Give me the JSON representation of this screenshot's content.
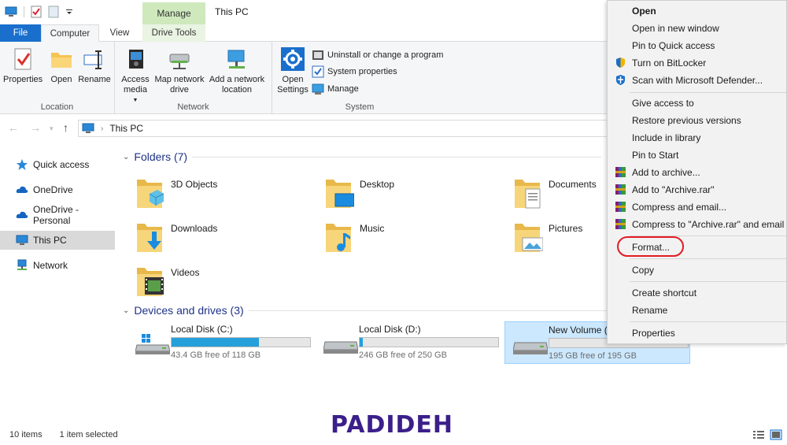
{
  "window": {
    "title": "This PC",
    "context_tab_group": "Manage"
  },
  "tabs": [
    "File",
    "Computer",
    "View",
    "Drive Tools"
  ],
  "ribbon": {
    "location": {
      "label": "Location",
      "buttons": [
        "Properties",
        "Open",
        "Rename"
      ]
    },
    "network": {
      "label": "Network",
      "access_media": "Access media",
      "map_network_drive": "Map network drive",
      "add_network_location": "Add a network location"
    },
    "system": {
      "label": "System",
      "open_settings": "Open Settings",
      "uninstall": "Uninstall or change a program",
      "system_properties": "System properties",
      "manage": "Manage"
    }
  },
  "address": {
    "path": "This PC"
  },
  "sidebar": {
    "items": [
      {
        "label": "Quick access",
        "icon": "star-icon"
      },
      {
        "label": "OneDrive",
        "icon": "cloud-icon"
      },
      {
        "label": "OneDrive - Personal",
        "icon": "cloud-icon"
      },
      {
        "label": "This PC",
        "icon": "computer-icon",
        "selected": true
      },
      {
        "label": "Network",
        "icon": "network-icon"
      }
    ]
  },
  "folders": {
    "heading": "Folders (7)",
    "items": [
      "3D Objects",
      "Desktop",
      "Documents",
      "Downloads",
      "Music",
      "Pictures",
      "Videos"
    ]
  },
  "drives": {
    "heading": "Devices and drives (3)",
    "items": [
      {
        "name": "Local Disk (C:)",
        "free": "43.4 GB free of 118 GB",
        "used_fraction": 0.63
      },
      {
        "name": "Local Disk (D:)",
        "free": "246 GB free of 250 GB",
        "used_fraction": 0.02
      },
      {
        "name": "New Volume (E",
        "free": "195 GB free of 195 GB",
        "used_fraction": 0.0
      }
    ]
  },
  "status": {
    "items_count": "10 items",
    "selection": "1 item selected"
  },
  "watermark": "PADIDEH",
  "context_menu": {
    "items": [
      {
        "label": "Open",
        "bold": true
      },
      {
        "label": "Open in new window"
      },
      {
        "label": "Pin to Quick access"
      },
      {
        "label": "Turn on BitLocker",
        "icon": "shield-icon"
      },
      {
        "label": "Scan with Microsoft Defender...",
        "icon": "defender-icon"
      },
      {
        "label": "Give access to"
      },
      {
        "label": "Restore previous versions"
      },
      {
        "label": "Include in library"
      },
      {
        "label": "Pin to Start"
      },
      {
        "label": "Add to archive...",
        "icon": "winrar-icon"
      },
      {
        "label": "Add to \"Archive.rar\"",
        "icon": "winrar-icon"
      },
      {
        "label": "Compress and email...",
        "icon": "winrar-icon"
      },
      {
        "label": "Compress to \"Archive.rar\" and email",
        "icon": "winrar-icon"
      },
      {
        "label": "Format..."
      },
      {
        "label": "Copy"
      },
      {
        "label": "Create shortcut"
      },
      {
        "label": "Rename"
      },
      {
        "label": "Properties"
      }
    ],
    "highlighted": "Format..."
  },
  "colors": {
    "accent": "#1a6fcc",
    "progress": "#26a0da",
    "selection": "#cce8ff",
    "highlight_ring": "#e11b22",
    "watermark": "#3b1f8a"
  }
}
